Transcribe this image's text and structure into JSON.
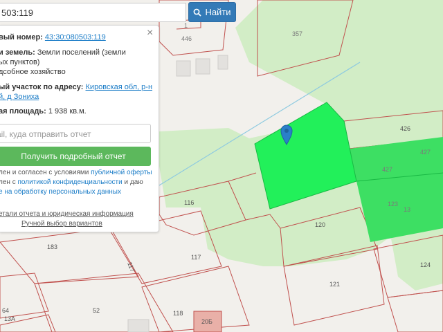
{
  "search": {
    "value": "503:119",
    "button_label": "Найти"
  },
  "panel": {
    "cad_number_label": "вый номер:",
    "cad_number": "43:30:080503:119",
    "category_label": "и земель:",
    "category_line1": "Земли поселений (земли",
    "category_line2": "ых пунктов)",
    "use_line": "дсобное хозяйство",
    "address_label": "ый участок по адресу:",
    "address_line1": "Кировская обл, р-н",
    "address_line2": "й, д Зониха",
    "area_label": "ая площадь:",
    "area_value": "1 938 кв.м.",
    "email_placeholder": "ail, куда отправить отчет",
    "report_button": "Получить подробный отчет",
    "consent_line1_a": "лен и согласен с условиями ",
    "consent_line1_link": "публичной оферты",
    "consent_line2_a": "лен с ",
    "consent_line2_link": "политикой конфиденциальности",
    "consent_line2_b": " и даю",
    "consent_line3_link": "е на обработку персональных данных",
    "details_link": "етали отчета и юридическая информация",
    "manual_link": "Ручной выбор вариантов"
  },
  "map": {
    "labels": {
      "p446": "446",
      "p1": "1",
      "p357": "357",
      "p426": "426",
      "p427a": "427",
      "p427b": "427",
      "p116": "116",
      "p120": "120",
      "p183": "183",
      "p117a": "117",
      "p117b": "117",
      "p123": "123",
      "p13": "13",
      "p124": "124",
      "p121": "121",
      "p52": "52",
      "p118": "118",
      "p20b": "20Б",
      "p64": "64",
      "p13a": "13А"
    },
    "colors": {
      "selected": "#22f05a",
      "neighbor": "#3ddf63",
      "greenery": "#d0edc3",
      "boundary": "#c0504d",
      "marker": "#2a7fc9"
    }
  }
}
